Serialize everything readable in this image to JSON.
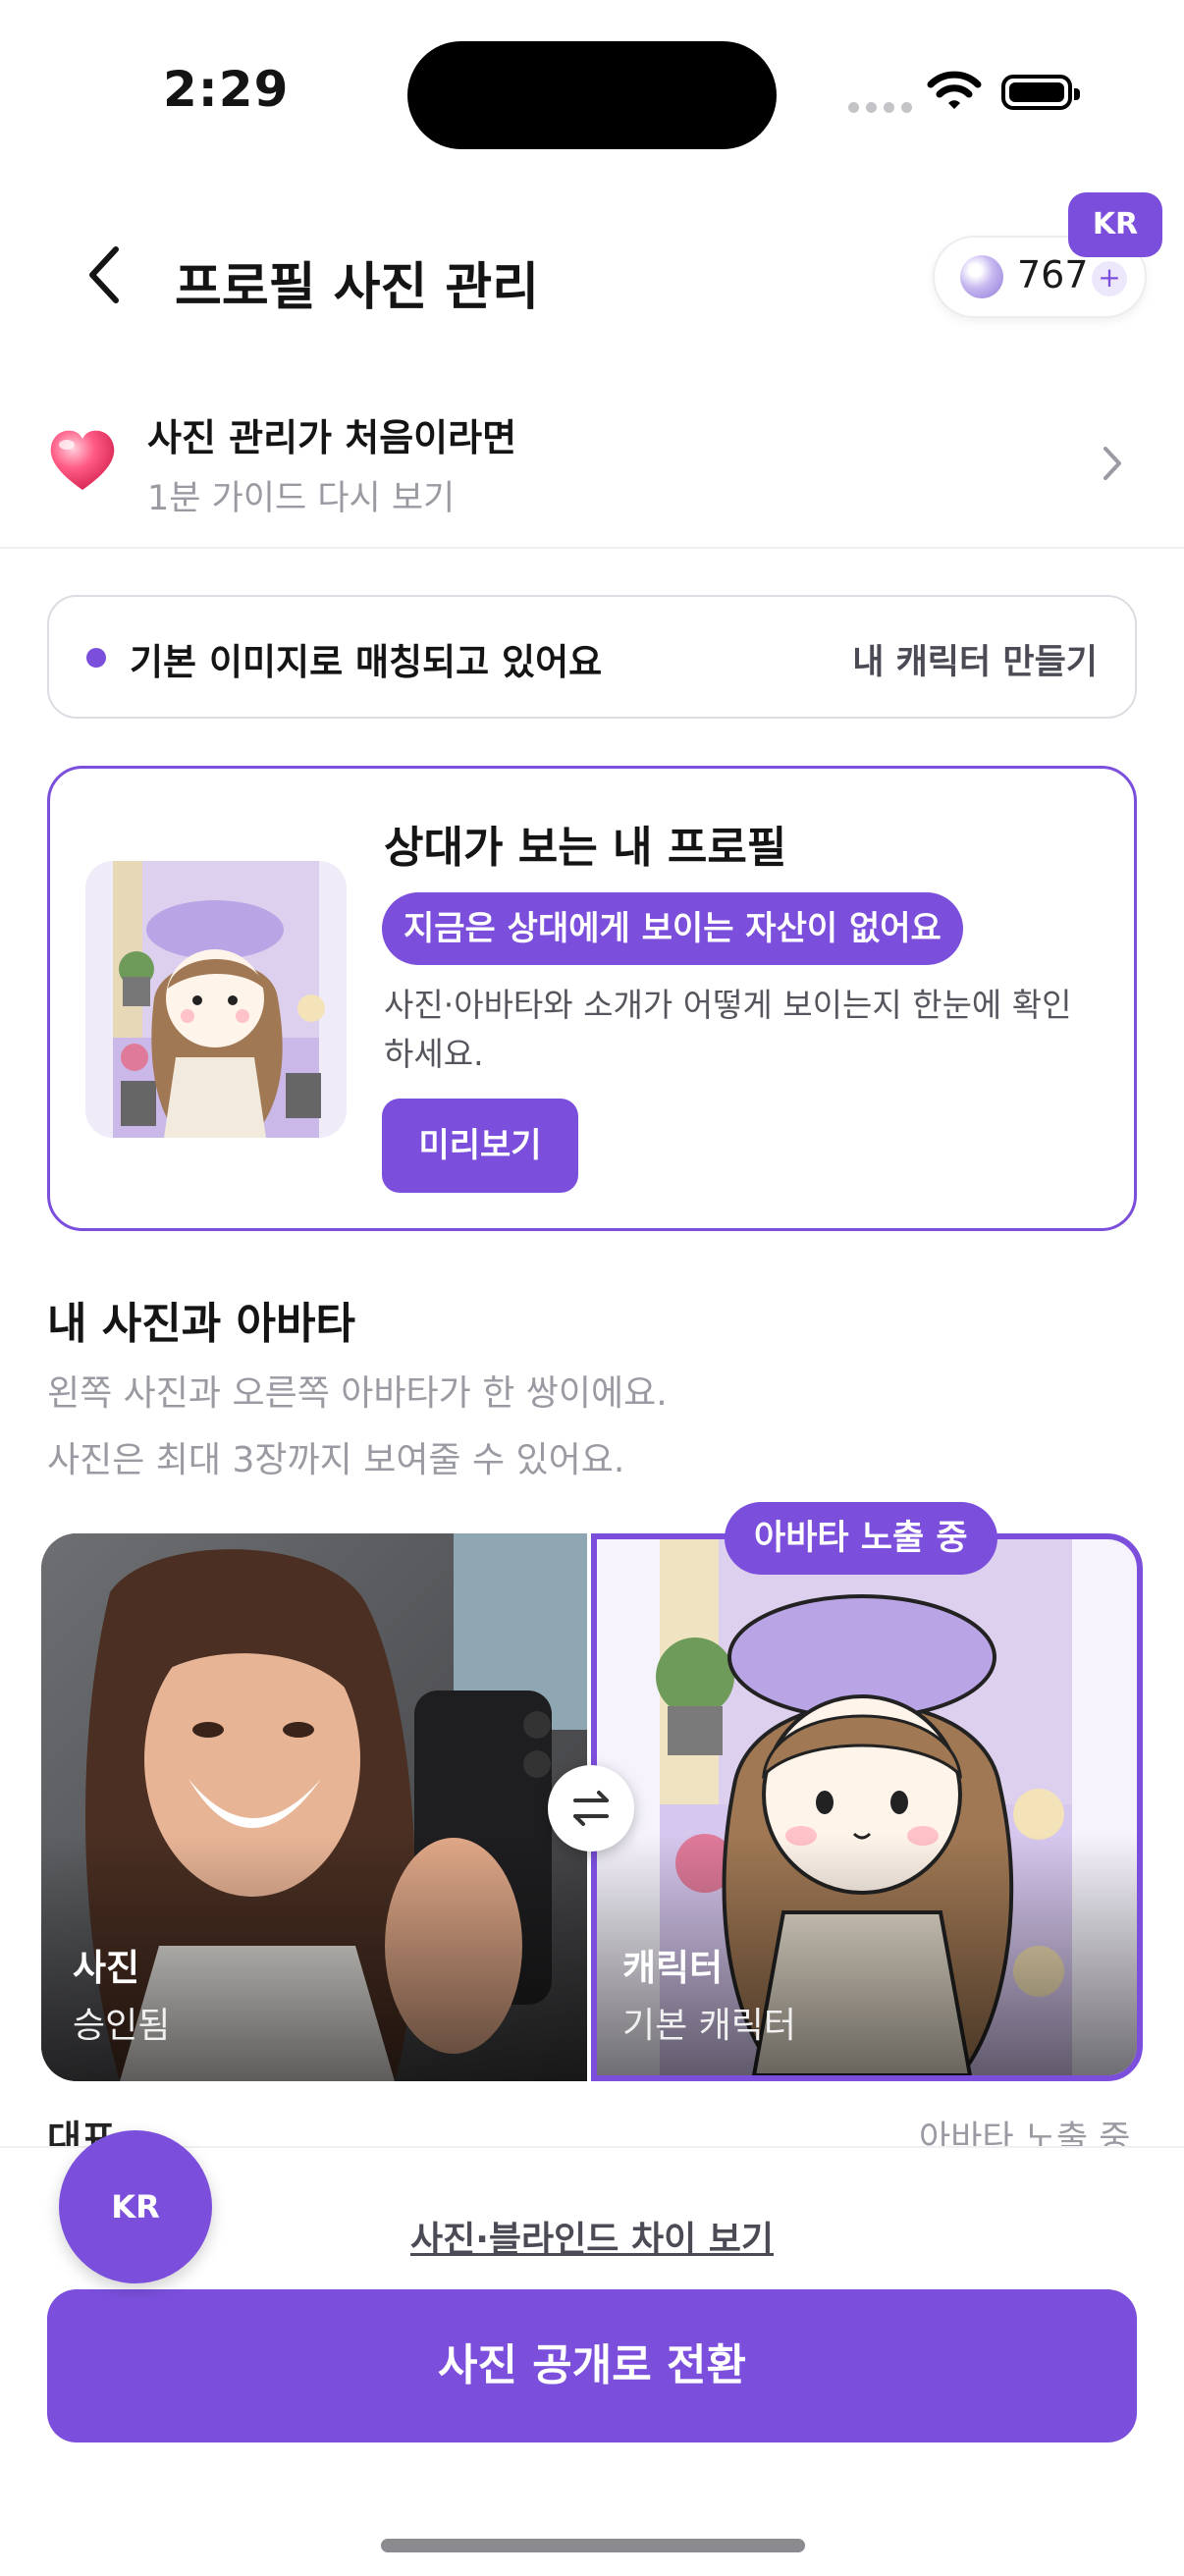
{
  "status_bar": {
    "time": "2:29"
  },
  "header": {
    "title": "프로필 사진 관리",
    "credits": "767",
    "credit_plus": "+",
    "region_badge": "KR"
  },
  "guide": {
    "title": "사진 관리가 처음이라면",
    "subtitle": "1분 가이드 다시 보기"
  },
  "match_status": {
    "text": "기본 이미지로 매칭되고 있어요",
    "action": "내 캐릭터 만들기"
  },
  "preview": {
    "title": "상대가 보는 내 프로필",
    "chip": "지금은 상대에게 보이는 자산이 없어요",
    "description": "사진·아바타와 소개가 어떻게 보이는지 한눈에 확인하세요.",
    "button": "미리보기"
  },
  "section": {
    "title": "내 사진과 아바타",
    "desc1": "왼쪽 사진과 오른쪽 아바타가 한 쌍이에요.",
    "desc2": "사진은 최대 3장까지 보여줄 수 있어요."
  },
  "pair": {
    "photo_label": "사진",
    "photo_status": "승인됨",
    "avatar_chip": "아바타 노출 중",
    "avatar_label": "캐릭터",
    "avatar_status": "기본 캐릭터"
  },
  "partial_row": {
    "left": "대표",
    "right": "아바타 노출 중"
  },
  "bottom": {
    "diff_link": "사진·블라인드 차이 보기",
    "cta": "사진 공개로 전환",
    "fab": "KR"
  },
  "colors": {
    "accent": "#7b4fdc",
    "muted": "#9a9aa2"
  }
}
